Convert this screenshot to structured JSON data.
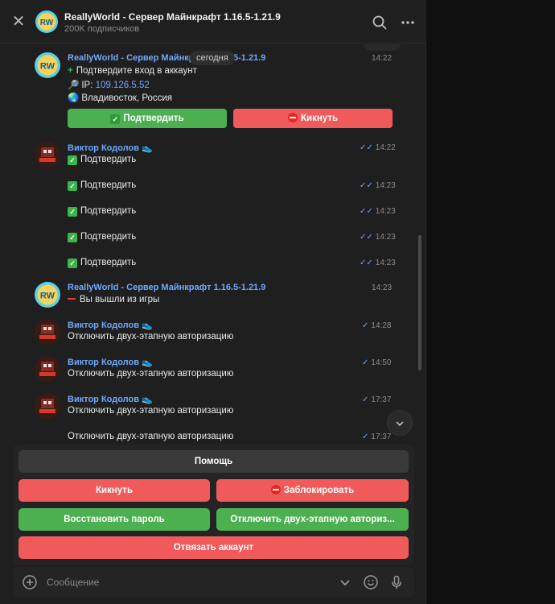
{
  "header": {
    "title": "ReallyWorld - Сервер Майнкрафт 1.16.5-1.21.9",
    "subtitle": "200K подписчиков"
  },
  "date_pill": "сегодня",
  "messages": {
    "m1": {
      "sender": "ReallyWorld - Сервер Майнкрафт 1.16.5-1.21.9",
      "time": "14:22",
      "line1": "Подтвердите вход в аккаунт",
      "ip_label": "IP:",
      "ip_value": "109.126.5.52",
      "location": "Владивосток, Россия",
      "confirm_button": "Подтвердить",
      "kick_button": "Кикнуть"
    },
    "m2": {
      "sender": "Виктор Кодолов",
      "time": "14:22",
      "text": "Подтвердить"
    },
    "m3": {
      "time": "14:23",
      "text": "Подтвердить"
    },
    "m4": {
      "time": "14:23",
      "text": "Подтвердить"
    },
    "m5": {
      "time": "14:23",
      "text": "Подтвердить"
    },
    "m6": {
      "time": "14:23",
      "text": "Подтвердить"
    },
    "m7": {
      "sender": "ReallyWorld - Сервер Майнкрафт 1.16.5-1.21.9",
      "time": "14:23",
      "text": "Вы вышли из игры"
    },
    "m8": {
      "sender": "Виктор Кодолов",
      "time": "14:28",
      "text": "Отключить двух-этапную авторизацию"
    },
    "m9": {
      "sender": "Виктор Кодолов",
      "time": "14:50",
      "text": "Отключить двух-этапную авторизацию"
    },
    "m10": {
      "sender": "Виктор Кодолов",
      "time": "17:37",
      "text": "Отключить двух-этапную авторизацию"
    },
    "m11": {
      "time": "17:37",
      "text": "Отключить двух-этапную авторизацию"
    }
  },
  "keyboard": {
    "help": "Помощь",
    "kick": "Кикнуть",
    "block": "Заблокировать",
    "restore_password": "Восстановить пароль",
    "disable_2fa": "Отключить двух-этапную авториз...",
    "unlink": "Отвязать аккаунт"
  },
  "input": {
    "placeholder": "Сообщение"
  },
  "colors": {
    "accent": "#6fa8ff",
    "green_button": "#4caf50",
    "red_button": "#f05a5a",
    "background": "#1f1f1f"
  }
}
